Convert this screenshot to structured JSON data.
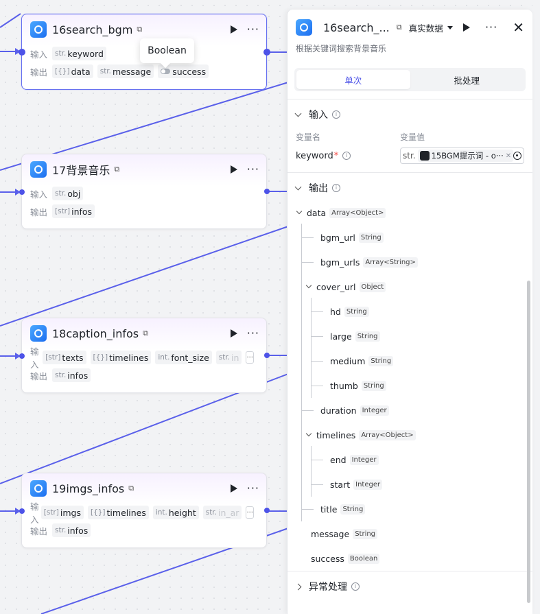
{
  "canvas": {
    "nodes": [
      {
        "id": "n16",
        "title": "16search_bgm",
        "input_label": "输入",
        "output_label": "输出",
        "inputs": [
          {
            "type": "str.",
            "name": "keyword"
          }
        ],
        "outputs": [
          {
            "type": "[{}]",
            "name": "data"
          },
          {
            "type": "str.",
            "name": "message"
          },
          {
            "type": "",
            "name": "success"
          }
        ]
      },
      {
        "id": "n17",
        "title": "17背景音乐",
        "input_label": "输入",
        "output_label": "输出",
        "inputs": [
          {
            "type": "str.",
            "name": "obj"
          }
        ],
        "outputs": [
          {
            "type": "[str]",
            "name": "infos"
          }
        ]
      },
      {
        "id": "n18",
        "title": "18caption_infos",
        "input_label": "输入",
        "output_label": "输出",
        "inputs": [
          {
            "type": "[str]",
            "name": "texts"
          },
          {
            "type": "[{}]",
            "name": "timelines"
          },
          {
            "type": "int.",
            "name": "font_size"
          },
          {
            "type": "str.",
            "name": "in"
          }
        ],
        "outputs": [
          {
            "type": "str.",
            "name": "infos"
          }
        ]
      },
      {
        "id": "n19",
        "title": "19imgs_infos",
        "input_label": "输入",
        "output_label": "输出",
        "inputs": [
          {
            "type": "[str]",
            "name": "imgs"
          },
          {
            "type": "[{}]",
            "name": "timelines"
          },
          {
            "type": "int.",
            "name": "height"
          },
          {
            "type": "str.",
            "name": "in_ar"
          }
        ],
        "outputs": [
          {
            "type": "str.",
            "name": "infos"
          }
        ]
      }
    ],
    "tooltip": "Boolean",
    "more_label": "···"
  },
  "panel": {
    "title": "16search_...",
    "mode": "真实数据",
    "description": "根据关键词搜索背景音乐",
    "tabs": [
      "单次",
      "批处理"
    ],
    "input_section": "输入",
    "col_name": "变量名",
    "col_value": "变量值",
    "keyword_label": "keyword",
    "keyword_type": "str.",
    "keyword_ref": "15BGM提示词 - o···",
    "output_section": "输出",
    "tree": [
      {
        "name": "data",
        "type": "Array<Object>"
      },
      {
        "name": "bgm_url",
        "type": "String"
      },
      {
        "name": "bgm_urls",
        "type": "Array<String>"
      },
      {
        "name": "cover_url",
        "type": "Object"
      },
      {
        "name": "hd",
        "type": "String"
      },
      {
        "name": "large",
        "type": "String"
      },
      {
        "name": "medium",
        "type": "String"
      },
      {
        "name": "thumb",
        "type": "String"
      },
      {
        "name": "duration",
        "type": "Integer"
      },
      {
        "name": "timelines",
        "type": "Array<Object>"
      },
      {
        "name": "end",
        "type": "Integer"
      },
      {
        "name": "start",
        "type": "Integer"
      },
      {
        "name": "title",
        "type": "String"
      },
      {
        "name": "message",
        "type": "String"
      },
      {
        "name": "success",
        "type": "Boolean"
      }
    ],
    "exception_section": "异常处理"
  },
  "colors": {
    "accent": "#4d53e8",
    "edge": "#5a60ea"
  }
}
